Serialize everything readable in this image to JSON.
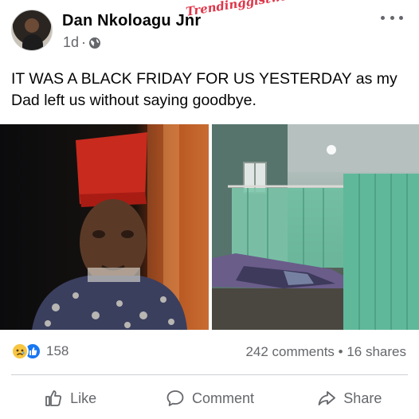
{
  "post": {
    "author": "Dan Nkoloagu Jnr",
    "time": "1d",
    "separator": "·",
    "privacy_icon": "globe-icon",
    "watermark": "TrendinggistwithNk",
    "text": "IT WAS A BLACK FRIDAY FOR US YESTERDAY as my Dad left us without saying goodbye."
  },
  "stats": {
    "reaction_icons": [
      "sad-reaction-icon",
      "like-reaction-icon"
    ],
    "reaction_count": "158",
    "comments_shares": "242 comments • 16 shares"
  },
  "actions": {
    "like": "Like",
    "comment": "Comment",
    "share": "Share"
  },
  "colors": {
    "secondary_text": "#65676b",
    "like_blue": "#1877f2",
    "watermark_red": "#e0364a"
  }
}
